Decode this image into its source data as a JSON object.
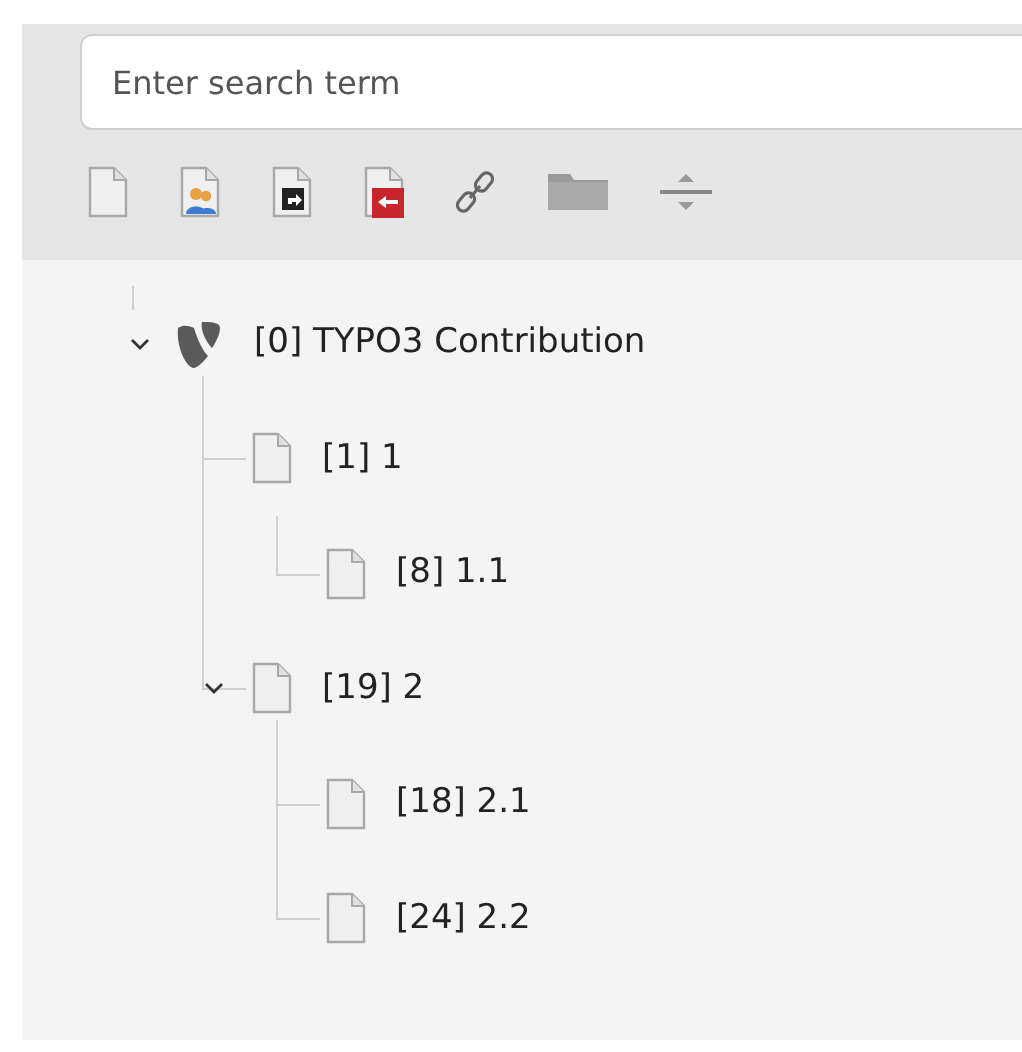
{
  "search": {
    "placeholder": "Enter search term"
  },
  "tree": [
    {
      "kind": "root",
      "label": "[0] TYPO3 Contribution",
      "expanded": true,
      "children": [
        {
          "kind": "page",
          "label": "[1] 1",
          "children": [
            {
              "kind": "page",
              "label": "[8] 1.1"
            }
          ]
        },
        {
          "kind": "page",
          "label": "[19] 2",
          "expanded": true,
          "children": [
            {
              "kind": "page",
              "label": "[18] 2.1"
            },
            {
              "kind": "page",
              "label": "[24] 2.2"
            }
          ]
        }
      ]
    }
  ]
}
